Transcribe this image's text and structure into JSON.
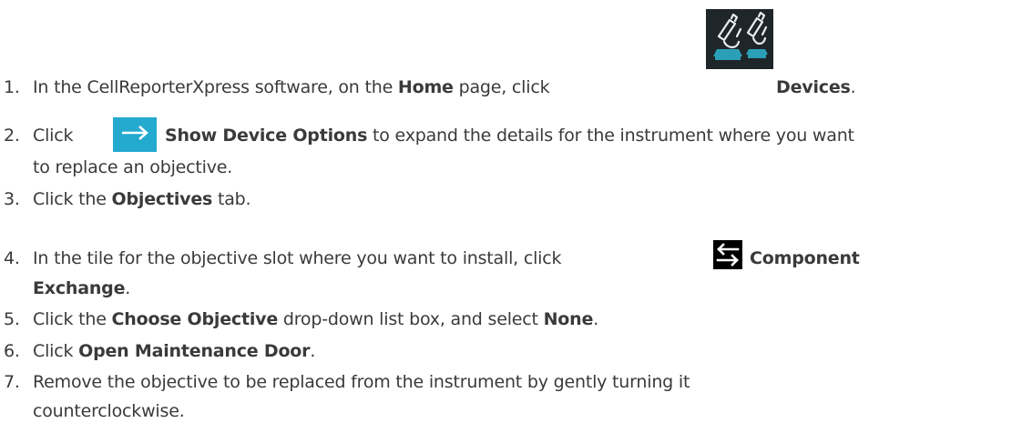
{
  "steps": [
    {
      "n": "1.",
      "parts": [
        {
          "t": "In the CellReporterXpress software, on the "
        },
        {
          "t": "Home",
          "b": true
        },
        {
          "t": " page, click "
        },
        {
          "icon": "devices-icon"
        },
        {
          "t": " "
        },
        {
          "t": "Devices",
          "b": true
        },
        {
          "t": "."
        }
      ]
    },
    {
      "n": "2.",
      "parts": [
        {
          "t": "Click "
        },
        {
          "icon": "arrow-right-icon"
        },
        {
          "t": " "
        },
        {
          "t": "Show Device Options",
          "b": true
        },
        {
          "t": " to expand the details for the instrument where you want"
        }
      ],
      "cont": "to replace an objective."
    },
    {
      "n": "3.",
      "parts": [
        {
          "t": "Click the "
        },
        {
          "t": "Objectives",
          "b": true
        },
        {
          "t": " tab."
        }
      ]
    },
    {
      "n": "4.",
      "parts": [
        {
          "t": "In the tile for the objective slot where you want to install, click "
        },
        {
          "icon": "component-exchange-icon"
        },
        {
          "t": " "
        },
        {
          "t": "Component",
          "b": true
        }
      ],
      "cont_bold": "Exchange",
      "cont_after": "."
    },
    {
      "n": "5.",
      "parts": [
        {
          "t": "Click the "
        },
        {
          "t": "Choose Objective",
          "b": true
        },
        {
          "t": " drop-down list box, and select "
        },
        {
          "t": "None",
          "b": true
        },
        {
          "t": "."
        }
      ]
    },
    {
      "n": "6.",
      "parts": [
        {
          "t": "Click "
        },
        {
          "t": "Open Maintenance Door",
          "b": true
        },
        {
          "t": "."
        }
      ]
    },
    {
      "n": "7.",
      "parts": [
        {
          "t": "Remove the objective to be replaced from the instrument by gently turning it"
        }
      ],
      "cont": "counterclockwise."
    }
  ],
  "colors": {
    "text": "#3a3a3a",
    "arrow_icon_bg": "#24a9cf",
    "devices_icon_bg": "#1f2629",
    "microscope_accent": "#2a9fb5"
  }
}
